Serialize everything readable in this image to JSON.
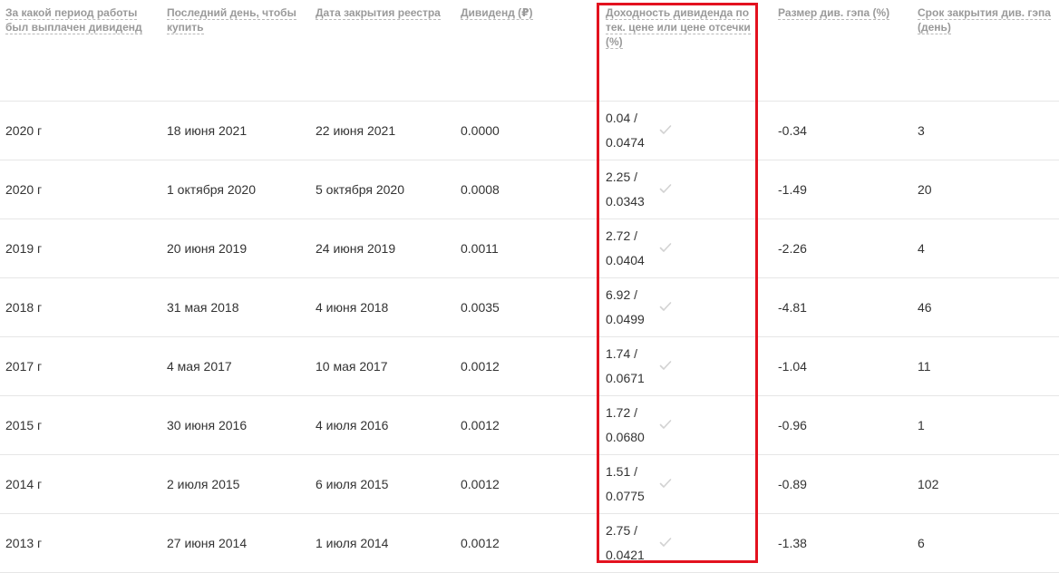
{
  "columns": [
    "За какой период работы был выплачен дивиденд",
    "Последний день, чтобы купить",
    "Дата закрытия реестра",
    "Дивиденд (₽)",
    "Доходность дивиденда по тек. цене или цене отсечки (%)",
    "Размер див. гэпа (%)",
    "Срок закрытия див. гэпа (день)"
  ],
  "rows": [
    {
      "period": "2020 г",
      "last_day": "18 июня 2021",
      "registry_close": "22 июня 2021",
      "dividend": "0.0000",
      "yield_current": "0.04 /",
      "yield_cutoff": "0.0474",
      "gap_size": "-0.34",
      "gap_close_days": "3",
      "check_icon": "check-icon"
    },
    {
      "period": "2020 г",
      "last_day": "1 октября 2020",
      "registry_close": "5 октября 2020",
      "dividend": "0.0008",
      "yield_current": "2.25 /",
      "yield_cutoff": "0.0343",
      "gap_size": "-1.49",
      "gap_close_days": "20",
      "check_icon": "check-icon"
    },
    {
      "period": "2019 г",
      "last_day": "20 июня 2019",
      "registry_close": "24 июня 2019",
      "dividend": "0.0011",
      "yield_current": "2.72 /",
      "yield_cutoff": "0.0404",
      "gap_size": "-2.26",
      "gap_close_days": "4",
      "check_icon": "check-icon"
    },
    {
      "period": "2018 г",
      "last_day": "31 мая 2018",
      "registry_close": "4 июня 2018",
      "dividend": "0.0035",
      "yield_current": "6.92 /",
      "yield_cutoff": "0.0499",
      "gap_size": "-4.81",
      "gap_close_days": "46",
      "check_icon": "check-icon"
    },
    {
      "period": "2017 г",
      "last_day": "4 мая 2017",
      "registry_close": "10 мая 2017",
      "dividend": "0.0012",
      "yield_current": "1.74 /",
      "yield_cutoff": "0.0671",
      "gap_size": "-1.04",
      "gap_close_days": "11",
      "check_icon": "check-icon"
    },
    {
      "period": "2015 г",
      "last_day": "30 июня 2016",
      "registry_close": "4 июля 2016",
      "dividend": "0.0012",
      "yield_current": "1.72 /",
      "yield_cutoff": "0.0680",
      "gap_size": "-0.96",
      "gap_close_days": "1",
      "check_icon": "check-icon"
    },
    {
      "period": "2014 г",
      "last_day": "2 июля 2015",
      "registry_close": "6 июля 2015",
      "dividend": "0.0012",
      "yield_current": "1.51 /",
      "yield_cutoff": "0.0775",
      "gap_size": "-0.89",
      "gap_close_days": "102",
      "check_icon": "check-icon"
    },
    {
      "period": "2013 г",
      "last_day": "27 июня 2014",
      "registry_close": "1 июля 2014",
      "dividend": "0.0012",
      "yield_current": "2.75 /",
      "yield_cutoff": "0.0421",
      "gap_size": "-1.38",
      "gap_close_days": "6",
      "check_icon": "check-icon"
    }
  ],
  "colors": {
    "header_text": "#9a9a9a",
    "body_text": "#333333",
    "row_border": "#e6e6e6",
    "highlight_border": "#e3121f",
    "check_icon": "#d2d2d2"
  }
}
